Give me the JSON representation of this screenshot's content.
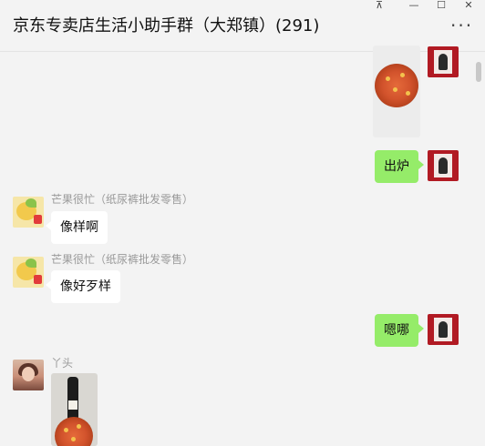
{
  "window": {
    "title": "京东专卖店生活小助手群（大郑镇）(291)",
    "controls": {
      "pin": "⊼",
      "minimize": "—",
      "maximize": "☐",
      "close": "✕"
    },
    "more": "···"
  },
  "messages": [
    {
      "sender": "me",
      "type": "image",
      "content": "pizza-photo"
    },
    {
      "sender": "me",
      "type": "text",
      "text": "出炉"
    },
    {
      "sender": "other",
      "name": "芒果很忙（纸尿裤批发零售）",
      "type": "text",
      "text": "像样啊"
    },
    {
      "sender": "other",
      "name": "芒果很忙（纸尿裤批发零售）",
      "type": "text",
      "text": "像好歹样"
    },
    {
      "sender": "me",
      "type": "text",
      "text": "嗯哪"
    },
    {
      "sender": "other",
      "name": "丫头",
      "type": "image",
      "content": "wine-and-pizza-photo"
    }
  ],
  "colors": {
    "my_bubble": "#95ec69",
    "other_bubble": "#ffffff",
    "background": "#f3f3f3"
  }
}
